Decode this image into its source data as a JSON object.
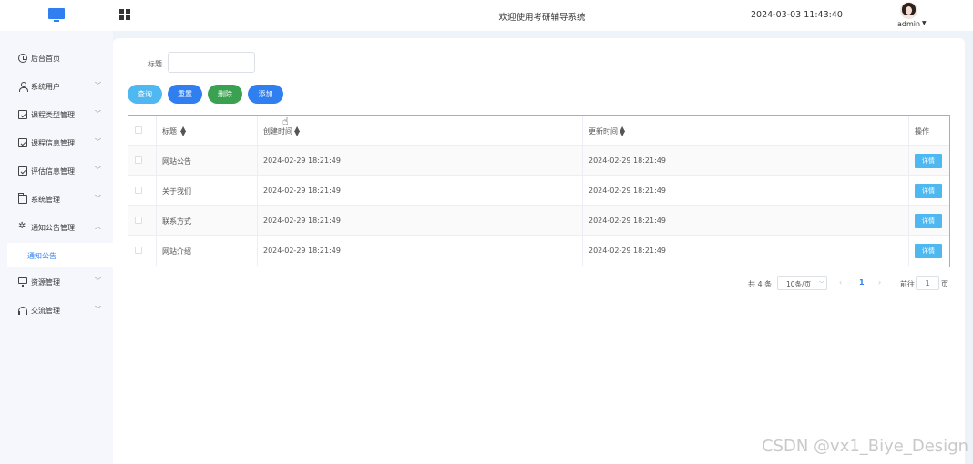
{
  "header": {
    "title": "欢迎使用考研辅导系统",
    "datetime": "2024-03-03 11:43:40",
    "user_name": "admin",
    "brand_color": "#2f7ff0"
  },
  "sidebar": {
    "items": [
      {
        "label": "后台首页",
        "icon": "clock-icon"
      },
      {
        "label": "系统用户",
        "icon": "user-icon"
      },
      {
        "label": "课程类型管理",
        "icon": "checkbox-icon"
      },
      {
        "label": "课程信息管理",
        "icon": "checkbox-icon"
      },
      {
        "label": "评估信息管理",
        "icon": "checkbox-icon"
      },
      {
        "label": "系统管理",
        "icon": "folder-icon"
      },
      {
        "label": "通知公告管理",
        "icon": "sparkle-icon"
      },
      {
        "label": "资源管理",
        "icon": "monitor-icon"
      },
      {
        "label": "交流管理",
        "icon": "headset-icon"
      }
    ],
    "active_sub_item": "通知公告"
  },
  "search": {
    "label": "标题",
    "value": ""
  },
  "buttons": {
    "query": "查询",
    "reset": "重置",
    "delete": "删除",
    "add": "添加"
  },
  "table": {
    "columns": [
      "标题",
      "创建时间",
      "更新时间",
      "操作"
    ],
    "rows": [
      {
        "title": "网站公告",
        "created": "2024-02-29 18:21:49",
        "updated": "2024-02-29 18:21:49",
        "action": "详情"
      },
      {
        "title": "关于我们",
        "created": "2024-02-29 18:21:49",
        "updated": "2024-02-29 18:21:49",
        "action": "详情"
      },
      {
        "title": "联系方式",
        "created": "2024-02-29 18:21:49",
        "updated": "2024-02-29 18:21:49",
        "action": "详情"
      },
      {
        "title": "网站介绍",
        "created": "2024-02-29 18:21:49",
        "updated": "2024-02-29 18:21:49",
        "action": "详情"
      }
    ]
  },
  "pagination": {
    "total": "共 4 条",
    "page_size": "10条/页",
    "current_page": "1",
    "goto_label": "前往",
    "goto_value": "1",
    "goto_unit": "页"
  },
  "watermark": "CSDN @vx1_Biye_Design"
}
